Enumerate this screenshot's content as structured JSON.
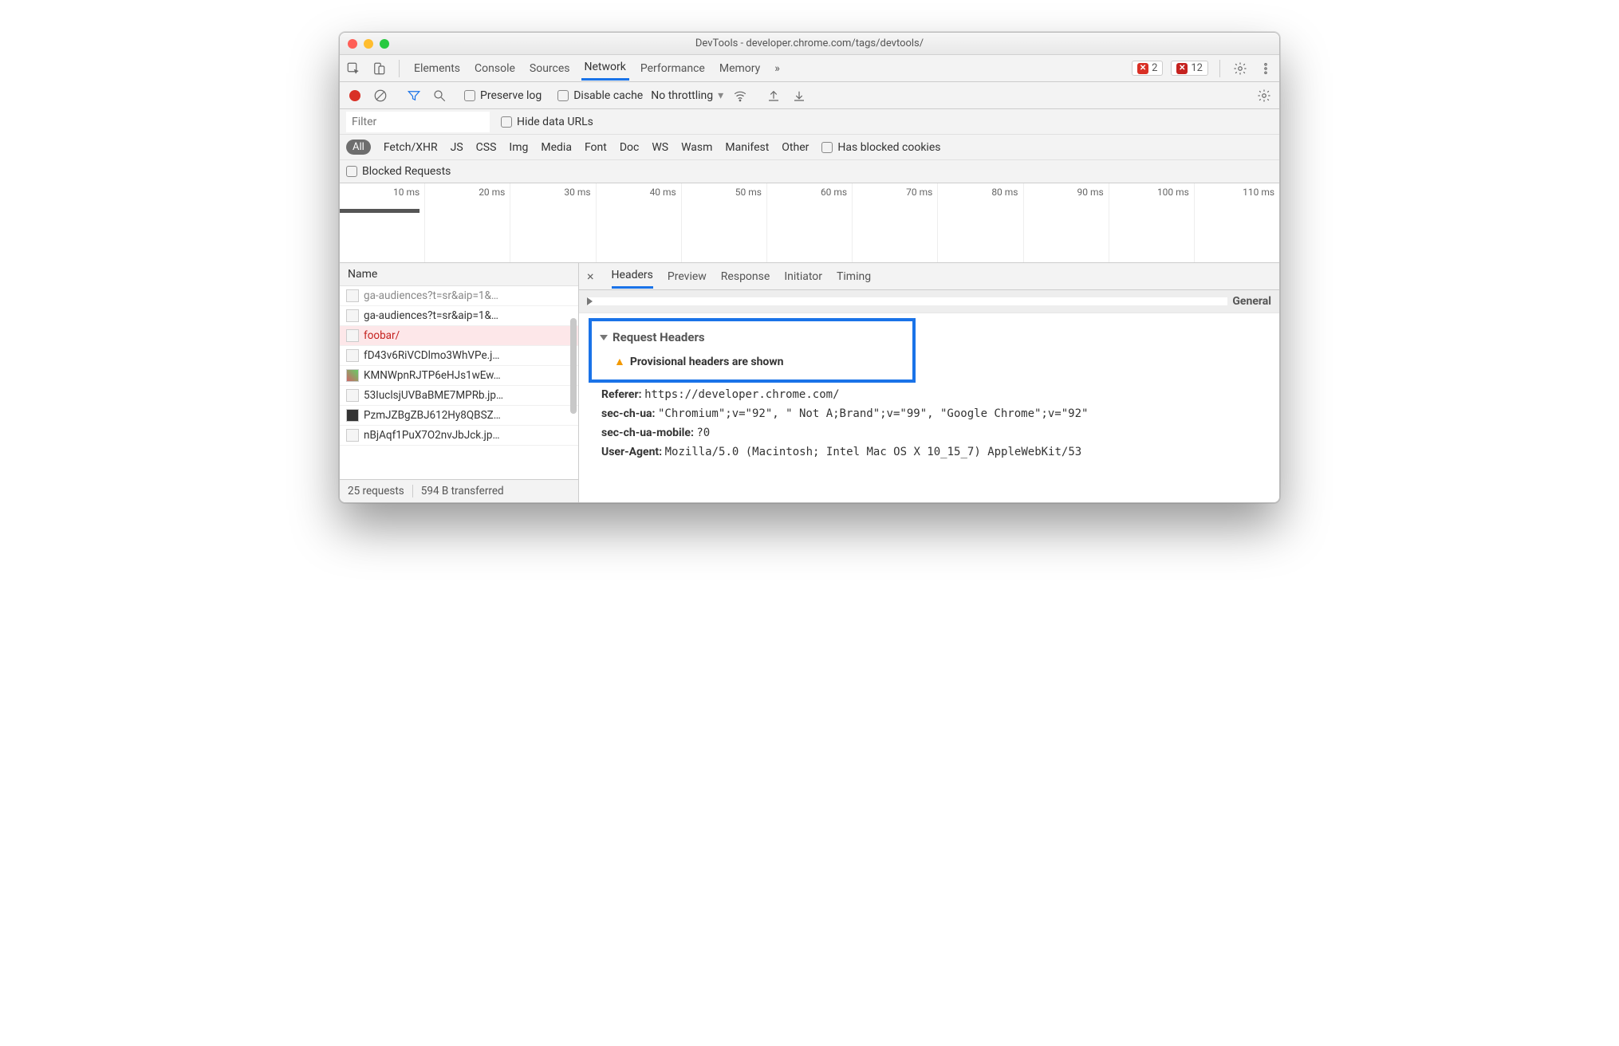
{
  "window": {
    "title": "DevTools - developer.chrome.com/tags/devtools/"
  },
  "tabs": {
    "items": [
      "Elements",
      "Console",
      "Sources",
      "Network",
      "Performance",
      "Memory"
    ],
    "active": "Network",
    "overflow": "»"
  },
  "counts": {
    "errors": "2",
    "critical": "12"
  },
  "subbar": {
    "preserve_log": "Preserve log",
    "disable_cache": "Disable cache",
    "throttling": "No throttling"
  },
  "filter": {
    "placeholder": "Filter",
    "hide_data_urls": "Hide data URLs",
    "types": [
      "All",
      "Fetch/XHR",
      "JS",
      "CSS",
      "Img",
      "Media",
      "Font",
      "Doc",
      "WS",
      "Wasm",
      "Manifest",
      "Other"
    ],
    "blocked_cookies": "Has blocked cookies",
    "blocked_requests": "Blocked Requests"
  },
  "timeline": {
    "ticks": [
      "10 ms",
      "20 ms",
      "30 ms",
      "40 ms",
      "50 ms",
      "60 ms",
      "70 ms",
      "80 ms",
      "90 ms",
      "100 ms",
      "110 ms"
    ]
  },
  "requests": {
    "header": "Name",
    "items": [
      {
        "name": "ga-audiences?t=sr&aip=1&…",
        "truncated": true
      },
      {
        "name": "ga-audiences?t=sr&aip=1&…"
      },
      {
        "name": "foobar/",
        "selected": true
      },
      {
        "name": "fD43v6RiVCDlmo3WhVPe.j…"
      },
      {
        "name": "KMNWpnRJTP6eHJs1wEw…"
      },
      {
        "name": "53IuclsjUVBaBME7MPRb.jp…"
      },
      {
        "name": "PzmJZBgZBJ612Hy8QBSZ…"
      },
      {
        "name": "nBjAqf1PuX7O2nvJbJck.jp…"
      }
    ],
    "status": {
      "count": "25 requests",
      "transferred": "594 B transferred"
    }
  },
  "detail": {
    "tabs": [
      "Headers",
      "Preview",
      "Response",
      "Initiator",
      "Timing"
    ],
    "active": "Headers",
    "general_label": "General",
    "request_headers_label": "Request Headers",
    "provisional": "Provisional headers are shown",
    "headers": {
      "referer_k": "Referer:",
      "referer_v": "https://developer.chrome.com/",
      "secua_k": "sec-ch-ua:",
      "secua_v": "\"Chromium\";v=\"92\", \" Not A;Brand\";v=\"99\", \"Google Chrome\";v=\"92\"",
      "secuamobile_k": "sec-ch-ua-mobile:",
      "secuamobile_v": "?0",
      "ua_k": "User-Agent:",
      "ua_v": "Mozilla/5.0 (Macintosh; Intel Mac OS X 10_15_7) AppleWebKit/53"
    }
  }
}
